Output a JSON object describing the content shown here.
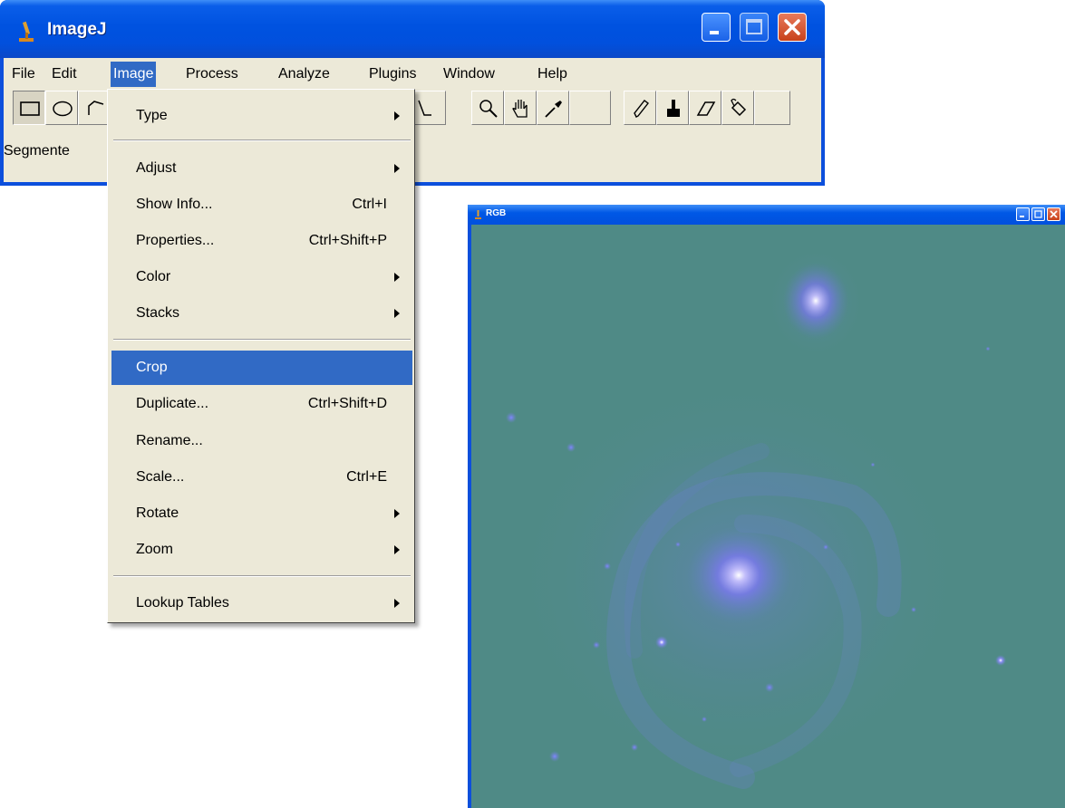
{
  "main_window": {
    "title": "ImageJ",
    "menubar": [
      "File",
      "Edit",
      "Image",
      "Process",
      "Analyze",
      "Plugins",
      "Window",
      "Help"
    ],
    "active_menu": "Image",
    "tools": [
      "rectangle-select",
      "oval-select",
      "polygon-select",
      "angle",
      "magnifier",
      "hand",
      "color-picker",
      "pencil",
      "paintbrush",
      "eraser",
      "flood-fill"
    ],
    "status": "Segmente"
  },
  "image_menu": {
    "items": [
      {
        "label": "Type",
        "shortcut": "",
        "submenu": true
      },
      {
        "label": "Adjust",
        "shortcut": "",
        "submenu": true
      },
      {
        "label": "Show Info...",
        "shortcut": "Ctrl+I",
        "submenu": false
      },
      {
        "label": "Properties...",
        "shortcut": "Ctrl+Shift+P",
        "submenu": false
      },
      {
        "label": "Color",
        "shortcut": "",
        "submenu": true
      },
      {
        "label": "Stacks",
        "shortcut": "",
        "submenu": true
      },
      {
        "label": "Crop",
        "shortcut": "",
        "submenu": false,
        "highlighted": true
      },
      {
        "label": "Duplicate...",
        "shortcut": "Ctrl+Shift+D",
        "submenu": false
      },
      {
        "label": "Rename...",
        "shortcut": "",
        "submenu": false
      },
      {
        "label": "Scale...",
        "shortcut": "Ctrl+E",
        "submenu": false
      },
      {
        "label": "Rotate",
        "shortcut": "",
        "submenu": true
      },
      {
        "label": "Zoom",
        "shortcut": "",
        "submenu": true
      },
      {
        "label": "Lookup Tables",
        "shortcut": "",
        "submenu": true
      }
    ]
  },
  "image_window": {
    "title": "RGB",
    "background_color": "#4f8a86",
    "accent_color": "#7b78f0"
  },
  "colors": {
    "xp_title_blue": "#0058e6",
    "menu_bg": "#ece9d8",
    "menu_highlight": "#316ac5"
  }
}
